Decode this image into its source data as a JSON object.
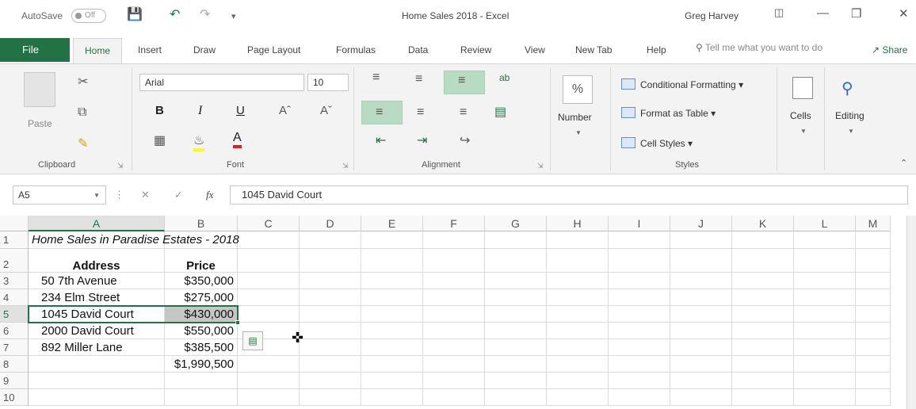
{
  "titlebar": {
    "autosave_label": "AutoSave",
    "autosave_state": "Off",
    "doc_title": "Home Sales 2018  -  Excel",
    "user": "Greg Harvey"
  },
  "tabs": {
    "file": "File",
    "home": "Home",
    "insert": "Insert",
    "draw": "Draw",
    "page_layout": "Page Layout",
    "formulas": "Formulas",
    "data": "Data",
    "review": "Review",
    "view": "View",
    "new_tab": "New Tab",
    "help": "Help",
    "tell_me": "Tell me what you want to do",
    "share": "Share"
  },
  "ribbon": {
    "clipboard": {
      "label": "Clipboard",
      "paste": "Paste"
    },
    "font": {
      "label": "Font",
      "name": "Arial",
      "size": "10"
    },
    "alignment": {
      "label": "Alignment"
    },
    "number": {
      "label": "Number"
    },
    "styles": {
      "label": "Styles",
      "conditional_formatting": "Conditional Formatting",
      "format_as_table": "Format as Table",
      "cell_styles": "Cell Styles"
    },
    "cells": {
      "label": "Cells"
    },
    "editing": {
      "label": "Editing"
    }
  },
  "formula_bar": {
    "name_box": "A5",
    "fx": "fx",
    "content": "1045 David Court"
  },
  "sheet": {
    "columns": [
      "A",
      "B",
      "C",
      "D",
      "E",
      "F",
      "G",
      "H",
      "I",
      "J",
      "K",
      "L",
      "M"
    ],
    "selected_column": "A",
    "rows": [
      "1",
      "2",
      "3",
      "4",
      "5",
      "6",
      "7",
      "8",
      "9",
      "10"
    ],
    "selected_row": "5",
    "title": "Home Sales in Paradise Estates - 2018",
    "headers": {
      "address": "Address",
      "price": "Price"
    },
    "data": [
      {
        "address": "50 7th Avenue",
        "price": "$350,000"
      },
      {
        "address": "234 Elm Street",
        "price": "$275,000"
      },
      {
        "address": "1045 David Court",
        "price": "$430,000"
      },
      {
        "address": "2000 David Court",
        "price": "$550,000"
      },
      {
        "address": "892 Miller Lane",
        "price": "$385,500"
      }
    ],
    "total": "$1,990,500"
  },
  "colors": {
    "excel_green": "#217346",
    "selection_fill": "#b7dcc3"
  }
}
